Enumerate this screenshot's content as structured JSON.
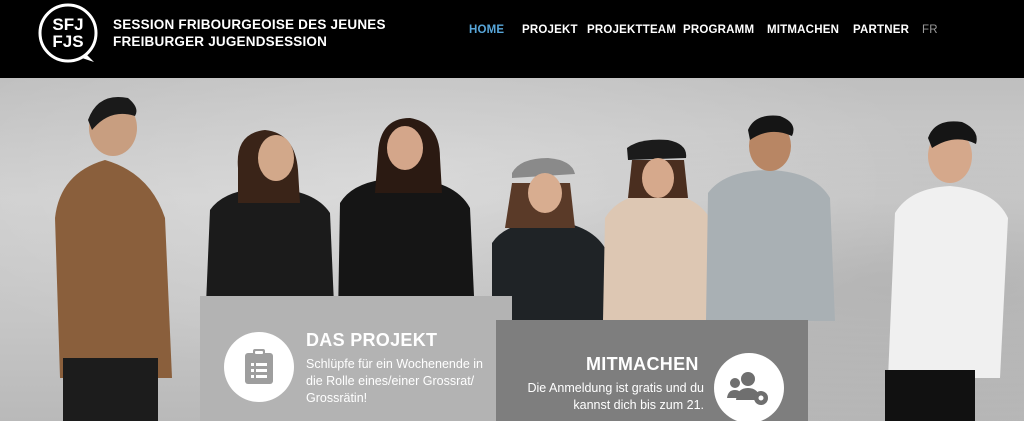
{
  "logo": {
    "line1": "SFJ",
    "line2": "FJS"
  },
  "brand": {
    "line1": "SESSION FRIBOURGEOISE DES JEUNES",
    "line2": "FREIBURGER JUGENDSESSION"
  },
  "nav": {
    "items": [
      {
        "label": "HOME"
      },
      {
        "label": "PROJEKT"
      },
      {
        "label": "PROJEKTTEAM"
      },
      {
        "label": "PROGRAMM"
      },
      {
        "label": "MITMACHEN"
      },
      {
        "label": "PARTNER"
      },
      {
        "label": "FR"
      }
    ]
  },
  "cards": {
    "projekt": {
      "title": "DAS PROJEKT",
      "text": "Schlüpfe für ein Wochenende in die Rolle eines/einer Grossrat/ Grossrätin!",
      "icon": "clipboard-icon"
    },
    "mitmachen": {
      "title": "MITMACHEN",
      "text": "Die Anmeldung ist gratis und du kannst dich bis zum 21.",
      "icon": "users-gear-icon"
    }
  },
  "colors": {
    "accent": "#58a6d9",
    "header_bg": "#000000",
    "card_light": "#b3b3b3",
    "card_dark": "#7e7e7e"
  }
}
